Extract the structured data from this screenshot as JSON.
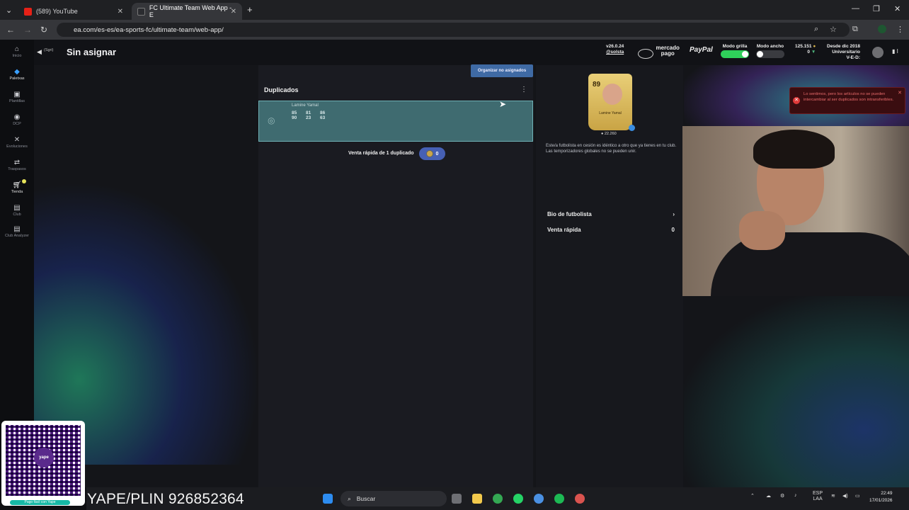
{
  "browser": {
    "tabs": [
      {
        "title": "(589) YouTube",
        "active": false
      },
      {
        "title": "FC Ultimate Team Web App - E",
        "active": true
      }
    ],
    "url": "ea.com/es-es/ea-sports-fc/ultimate-team/web-app/"
  },
  "sidebar": {
    "items": [
      {
        "label": "Inicio",
        "icon": "home-icon"
      },
      {
        "label": "Paletxas",
        "icon": "packs-icon"
      },
      {
        "label": "Plantillas",
        "icon": "squad-icon"
      },
      {
        "label": "DCP",
        "icon": "sbc-icon"
      },
      {
        "label": "Evoluciones",
        "icon": "evolutions-icon"
      },
      {
        "label": "Traspasos",
        "icon": "transfers-icon"
      },
      {
        "label": "Tienda",
        "icon": "store-icon"
      },
      {
        "label": "Club",
        "icon": "club-icon"
      },
      {
        "label": "Club Analyzer",
        "icon": "club-analyzer-icon"
      }
    ]
  },
  "header": {
    "back_sub": "(Sgri)",
    "title": "Sin asignar",
    "version": "v26.0.24",
    "user": "@solsta",
    "mercado": "mercado pago",
    "paypal": "PayPal",
    "grid_mode": "Modo grilla",
    "wide_mode": "Modo ancho",
    "coins": "125.151",
    "points": "0",
    "since": "Desde dic 2018",
    "club_name": "Universitario",
    "record": "V-E-D: ",
    "accent": "#2fd15a"
  },
  "center": {
    "organize_button": "Organizar no asignados",
    "section_title": "Duplicados",
    "player_name": "Lamine Yamal",
    "stats": [
      "85",
      "81",
      "86",
      "90",
      "23",
      "63"
    ],
    "quick_sell_text": "Venta rápida de 1 duplicado",
    "quick_sell_value": "0"
  },
  "detail": {
    "card_rating": "89",
    "card_name": "Lamine Yamal",
    "card_price": "22.260",
    "description": "Este/a futbolista en cesión es idéntico a otro que ya tienes en tu club. Las temporizadores globales no se pueden unir.",
    "bio_label": "Bio de futbolista",
    "quick_sell_label": "Venta rápida",
    "quick_sell_value": "0"
  },
  "toast": {
    "message": "Lo sentimos, pero los artículos no se pueden intercambiar al ser duplicados son intransferibles."
  },
  "overlay": {
    "qr_tag": "Pago fácil con Yape",
    "qr_logo": "yape",
    "yape_text": "YAPE/PLIN 926852364"
  },
  "taskbar": {
    "search": "Buscar",
    "lang": "ESP",
    "lang2": "LAA",
    "time": "22:49",
    "date": "17/01/2026"
  }
}
